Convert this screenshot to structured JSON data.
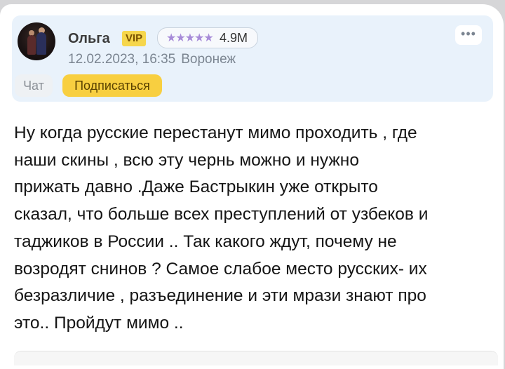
{
  "post": {
    "author": {
      "name": "Ольга",
      "vip_label": "VIP",
      "rating_stars": "★★★★★",
      "rating_value": "4.9M",
      "avatar_icon": "user-avatar-photo"
    },
    "meta": {
      "datetime": "12.02.2023, 16:35",
      "city": "Воронеж"
    },
    "actions": {
      "more_label": "•••",
      "chat_label": "Чат",
      "subscribe_label": "Подписаться"
    },
    "body": "Ну когда русские перестанут мимо проходить , где\nнаши скины , всю эту чернь можно и нужно\nприжать давно .Даже Бастрыкин уже открыто\nсказал, что больше всех преступлений от узбеков и\nтаджиков в России .. Так какого ждут, почему не\nвозродят снинов ? Самое слабое место русских- их\nбезразличие , разъединение и эти мрази знают про\nэто.. Пройдут мимо .."
  },
  "colors": {
    "header_bg": "#e9f2fb",
    "subscribe_bg": "#f8cf40",
    "vip_bg": "#f6d64c",
    "stars": "#a78bd8"
  }
}
